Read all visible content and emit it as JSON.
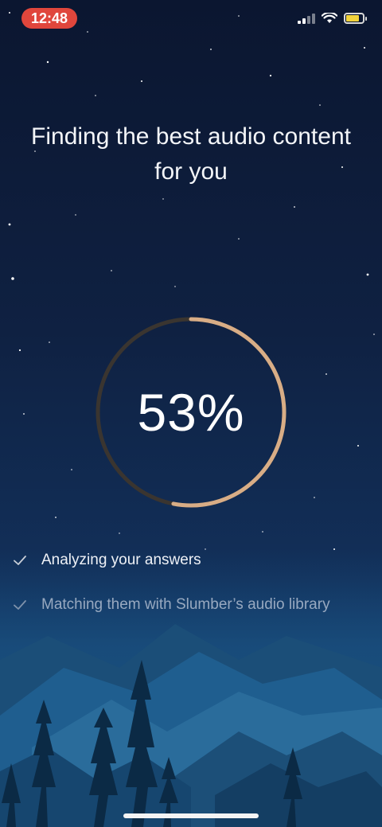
{
  "status_bar": {
    "time": "12:48",
    "signal_icon": "cellular-signal-icon",
    "wifi_icon": "wifi-icon",
    "battery_icon": "battery-icon",
    "battery_level": 0.65,
    "battery_color": "#f2d33b",
    "time_pill_color": "#e0463c"
  },
  "title": "Finding the best audio content for you",
  "progress": {
    "label": "53%",
    "value": 0.53,
    "track_color": "#3a3530",
    "fill_color": "#d8ad86"
  },
  "steps": [
    {
      "label": "Analyzing your answers",
      "icon": "checkmark-icon",
      "done": true
    },
    {
      "label": "Matching them with Slumber’s audio library",
      "icon": "checkmark-icon",
      "done": false
    }
  ],
  "colors": {
    "sky_top": "#0b1630",
    "mountain_blue": "#1d5a88",
    "tree_dark": "#0b2a45"
  }
}
